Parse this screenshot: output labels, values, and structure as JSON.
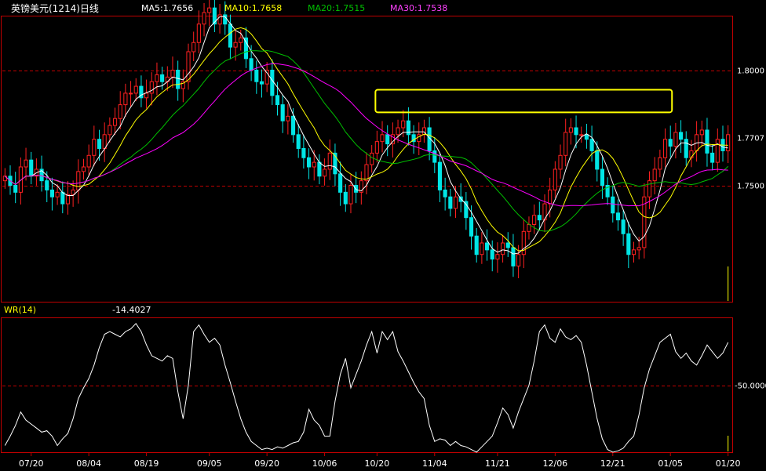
{
  "header": {
    "title": "英镑美元(1214)日线",
    "ma5": "MA5:1.7656",
    "ma10": "MA10:1.7658",
    "ma20": "MA20:1.7515",
    "ma30": "MA30:1.7538"
  },
  "indicator": {
    "label": "WR(14)",
    "value": "-14.4027"
  },
  "colors": {
    "background": "#000000",
    "up_candle": "#ff2020",
    "down_candle": "#00e5e5",
    "ma5": "#ffffff",
    "ma10": "#ffff00",
    "ma20": "#00c000",
    "ma30": "#ff00ff",
    "grid_line": "#c00000",
    "frame": "#c00000",
    "highlight_box": "#ffff00",
    "wr_line": "#ffffff"
  },
  "chart_data": {
    "type": "candlestick",
    "instrument": "英镑美元(1214)日线",
    "price_axis": {
      "labels": [
        "1.7707",
        "1.8000",
        "1.7500"
      ],
      "values": [
        1.7707,
        1.8,
        1.75
      ],
      "ylim": [
        1.6995,
        1.8233
      ],
      "grid": [
        1.8,
        1.75
      ]
    },
    "wr_axis": {
      "labels": [
        "-50.0000"
      ],
      "values": [
        -50
      ],
      "ylim": [
        -100,
        0
      ],
      "grid": [
        -50
      ]
    },
    "date_labels": [
      "07/20",
      "08/04",
      "08/19",
      "09/05",
      "09/20",
      "10/06",
      "10/20",
      "11/04",
      "11/21",
      "12/06",
      "12/21",
      "01/05",
      "01/20"
    ],
    "date_label_index": [
      5,
      16,
      27,
      39,
      50,
      61,
      71,
      82,
      94,
      105,
      116,
      127,
      138
    ],
    "closes": [
      1.754,
      1.75,
      1.747,
      1.758,
      1.761,
      1.754,
      1.757,
      1.752,
      1.748,
      1.745,
      1.747,
      1.742,
      1.746,
      1.748,
      1.756,
      1.758,
      1.763,
      1.77,
      1.766,
      1.772,
      1.776,
      1.779,
      1.785,
      1.79,
      1.79,
      1.793,
      1.788,
      1.79,
      1.795,
      1.798,
      1.795,
      1.797,
      1.8,
      1.792,
      1.795,
      1.808,
      1.812,
      1.82,
      1.825,
      1.827,
      1.82,
      1.824,
      1.82,
      1.81,
      1.812,
      1.814,
      1.805,
      1.8,
      1.795,
      1.794,
      1.8,
      1.789,
      1.785,
      1.778,
      1.78,
      1.772,
      1.766,
      1.762,
      1.758,
      1.76,
      1.754,
      1.757,
      1.764,
      1.755,
      1.747,
      1.742,
      1.75,
      1.747,
      1.752,
      1.759,
      1.764,
      1.769,
      1.772,
      1.768,
      1.772,
      1.775,
      1.778,
      1.772,
      1.769,
      1.772,
      1.775,
      1.765,
      1.76,
      1.748,
      1.745,
      1.74,
      1.745,
      1.743,
      1.736,
      1.728,
      1.72,
      1.725,
      1.722,
      1.718,
      1.72,
      1.725,
      1.723,
      1.715,
      1.72,
      1.73,
      1.733,
      1.737,
      1.735,
      1.742,
      1.748,
      1.757,
      1.763,
      1.773,
      1.775,
      1.772,
      1.772,
      1.77,
      1.765,
      1.757,
      1.75,
      1.745,
      1.738,
      1.735,
      1.729,
      1.72,
      1.722,
      1.723,
      1.745,
      1.752,
      1.757,
      1.762,
      1.77,
      1.767,
      1.773,
      1.77,
      1.762,
      1.765,
      1.772,
      1.774,
      1.764,
      1.76,
      1.77,
      1.765,
      1.772
    ],
    "wr_values": [
      -95,
      -88,
      -80,
      -70,
      -76,
      -79,
      -82,
      -85,
      -84,
      -88,
      -95,
      -90,
      -86,
      -75,
      -60,
      -52,
      -45,
      -35,
      -22,
      -12,
      -10,
      -12,
      -14,
      -10,
      -8,
      -4,
      -10,
      -20,
      -28,
      -30,
      -32,
      -28,
      -30,
      -55,
      -75,
      -50,
      -10,
      -5,
      -12,
      -18,
      -15,
      -20,
      -35,
      -48,
      -62,
      -75,
      -85,
      -92,
      -95,
      -98,
      -97,
      -98,
      -96,
      -97,
      -95,
      -93,
      -92,
      -85,
      -68,
      -76,
      -80,
      -88,
      -88,
      -62,
      -42,
      -30,
      -52,
      -42,
      -32,
      -20,
      -10,
      -26,
      -10,
      -16,
      -10,
      -25,
      -32,
      -40,
      -48,
      -55,
      -60,
      -80,
      -92,
      -90,
      -91,
      -95,
      -92,
      -95,
      -96,
      -98,
      -100,
      -96,
      -92,
      -88,
      -78,
      -67,
      -72,
      -82,
      -70,
      -60,
      -50,
      -32,
      -10,
      -5,
      -15,
      -18,
      -8,
      -14,
      -16,
      -13,
      -18,
      -35,
      -55,
      -75,
      -90,
      -98,
      -100,
      -99,
      -97,
      -92,
      -88,
      -72,
      -52,
      -38,
      -28,
      -18,
      -15,
      -12,
      -25,
      -30,
      -26,
      -32,
      -35,
      -28,
      -20,
      -25,
      -30,
      -26,
      -18
    ],
    "series": [
      {
        "name": "MA5",
        "window": 5
      },
      {
        "name": "MA10",
        "window": 10
      },
      {
        "name": "MA20",
        "window": 20
      },
      {
        "name": "MA30",
        "window": 30
      },
      {
        "name": "WR(14)",
        "panel": "indicator"
      }
    ],
    "annotations": [
      {
        "type": "highlight-rectangle",
        "color": "#ffff00",
        "price_range": [
          1.7817,
          1.7915
        ],
        "index_range": [
          71,
          127
        ]
      }
    ],
    "grid": true
  }
}
